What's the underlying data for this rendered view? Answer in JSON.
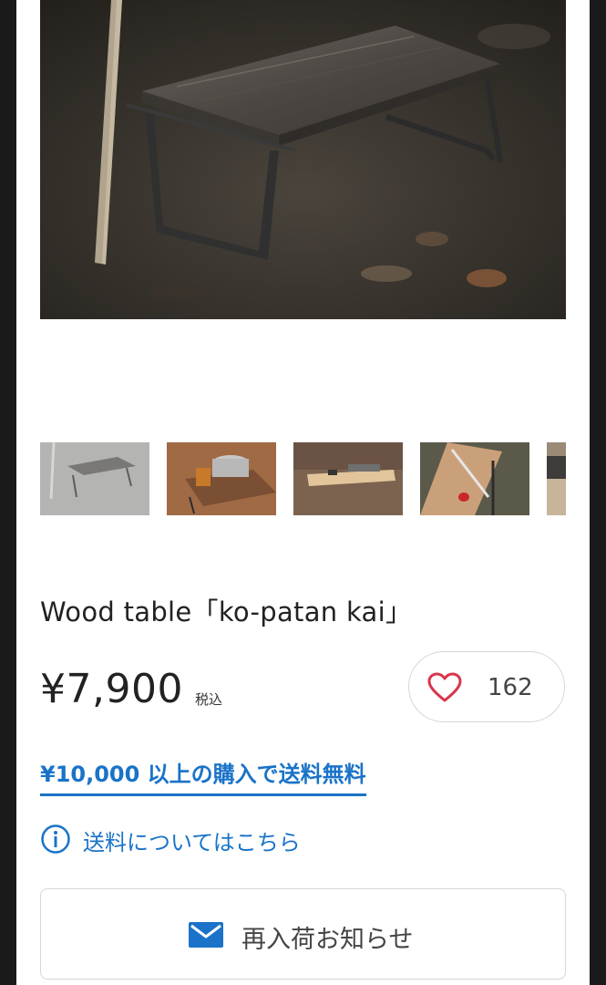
{
  "product": {
    "title": "Wood table「ko-patan kai」",
    "price": "¥7,900",
    "tax_label": "税込",
    "favorite_count": "162"
  },
  "images": {
    "main": "product-photo-table-on-ground",
    "thumbnails": [
      "thumb-table-foggy",
      "thumb-table-with-pot",
      "thumb-table-with-board",
      "thumb-table-with-tools",
      "thumb-table-partial"
    ]
  },
  "shipping": {
    "free_shipping_text": "¥10,000 以上の購入で送料無料",
    "info_link_text": "送料についてはこちら"
  },
  "restock": {
    "button_label": "再入荷お知らせ"
  },
  "icons": {
    "favorite": "heart-icon",
    "info": "info-icon",
    "mail": "mail-icon"
  },
  "colors": {
    "accent_blue": "#1a73c8",
    "heart_red": "#d9364a",
    "text": "#222222"
  }
}
